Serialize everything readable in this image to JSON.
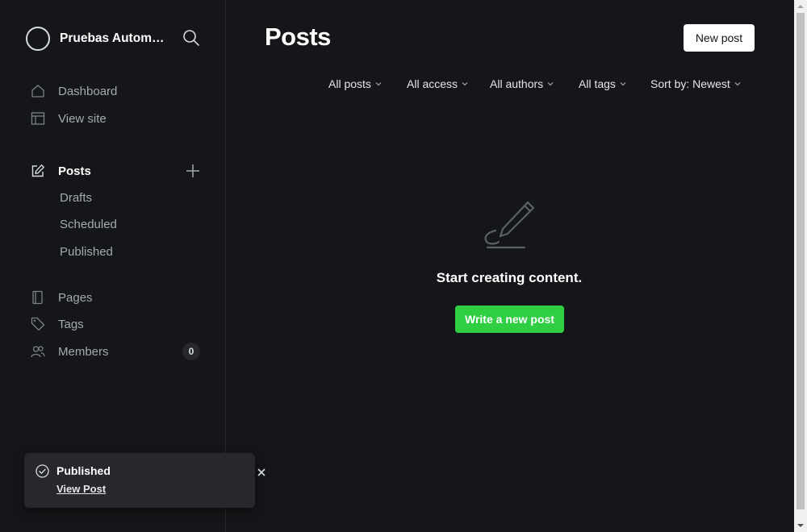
{
  "sidebar": {
    "site_name": "Pruebas Automatizadas",
    "nav": {
      "dashboard": "Dashboard",
      "view_site": "View site",
      "posts": "Posts",
      "drafts": "Drafts",
      "scheduled": "Scheduled",
      "published": "Published",
      "pages": "Pages",
      "tags": "Tags",
      "members": "Members",
      "members_count": "0"
    }
  },
  "main": {
    "title": "Posts",
    "new_post_label": "New post",
    "filters": [
      "All posts",
      "All access",
      "All authors",
      "All tags",
      "Sort by: Newest"
    ],
    "empty_state": {
      "message": "Start creating content.",
      "button": "Write a new post"
    }
  },
  "toast": {
    "title": "Published",
    "link": "View Post"
  },
  "colors": {
    "background": "#151619",
    "accent_green": "#30cf43",
    "text_primary": "#ffffff",
    "text_muted": "#a4a9ae"
  },
  "icons": {
    "brand": "site-logo-circle",
    "search": "search-icon",
    "dashboard": "house-icon",
    "view_site": "layout-icon",
    "posts": "pencil-square-icon",
    "add": "plus-icon",
    "pages": "document-icon",
    "tags": "tag-icon",
    "members": "users-icon",
    "empty_state": "pencil-icon",
    "toast_status": "check-circle-icon",
    "toast_close": "close-icon"
  }
}
